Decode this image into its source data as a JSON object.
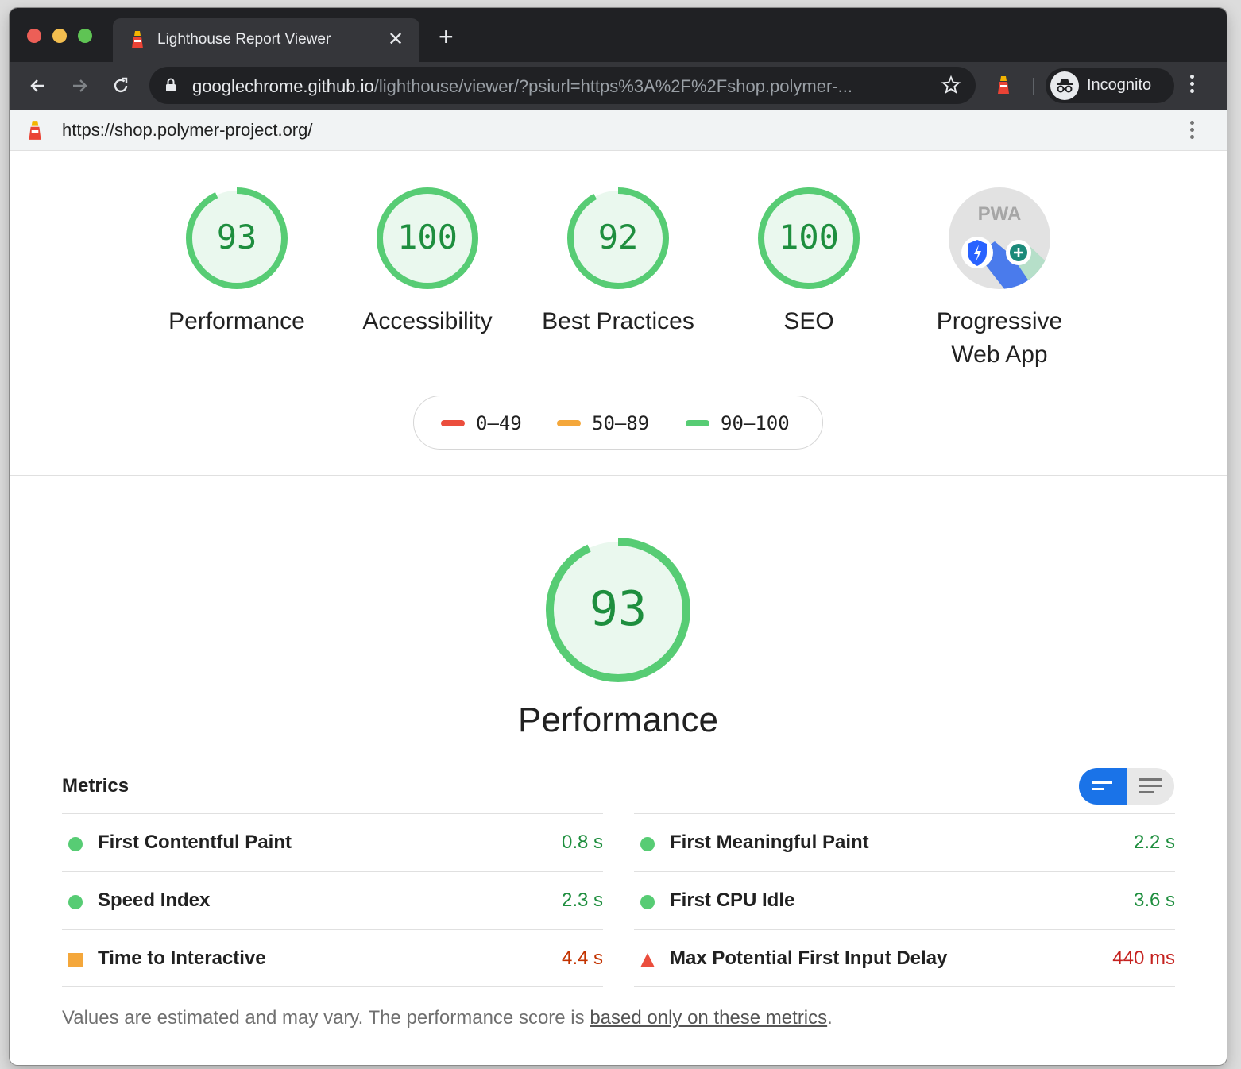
{
  "browser": {
    "tab_title": "Lighthouse Report Viewer",
    "url_host": "googlechrome.github.io",
    "url_path": "/lighthouse/viewer/?psiurl=https%3A%2F%2Fshop.polymer-...",
    "incognito_label": "Incognito"
  },
  "report": {
    "url": "https://shop.polymer-project.org/"
  },
  "categories": [
    {
      "label": "Performance",
      "score": "93"
    },
    {
      "label": "Accessibility",
      "score": "100"
    },
    {
      "label": "Best Practices",
      "score": "92"
    },
    {
      "label": "SEO",
      "score": "100"
    },
    {
      "label_line1": "Progressive",
      "label_line2": "Web App",
      "badge_text": "PWA"
    }
  ],
  "legend": [
    {
      "range": "0–49",
      "color": "#eb4e3d"
    },
    {
      "range": "50–89",
      "color": "#f4a73b"
    },
    {
      "range": "90–100",
      "color": "#57cc74"
    }
  ],
  "performance": {
    "score": "93",
    "title": "Performance"
  },
  "metrics": {
    "header": "Metrics",
    "left": [
      {
        "name": "First Contentful Paint",
        "value": "0.8 s",
        "status": "pass"
      },
      {
        "name": "Speed Index",
        "value": "2.3 s",
        "status": "pass"
      },
      {
        "name": "Time to Interactive",
        "value": "4.4 s",
        "status": "average"
      }
    ],
    "right": [
      {
        "name": "First Meaningful Paint",
        "value": "2.2 s",
        "status": "pass"
      },
      {
        "name": "First CPU Idle",
        "value": "3.6 s",
        "status": "pass"
      },
      {
        "name": "Max Potential First Input Delay",
        "value": "440 ms",
        "status": "fail"
      }
    ]
  },
  "footnote": {
    "text": "Values are estimated and may vary. The performance score is ",
    "link": "based only on these metrics",
    "end": "."
  },
  "colors": {
    "pass": "#1e8e3e",
    "average": "#c33300",
    "fail": "#c5221f",
    "gauge_green": "#57cc74"
  }
}
